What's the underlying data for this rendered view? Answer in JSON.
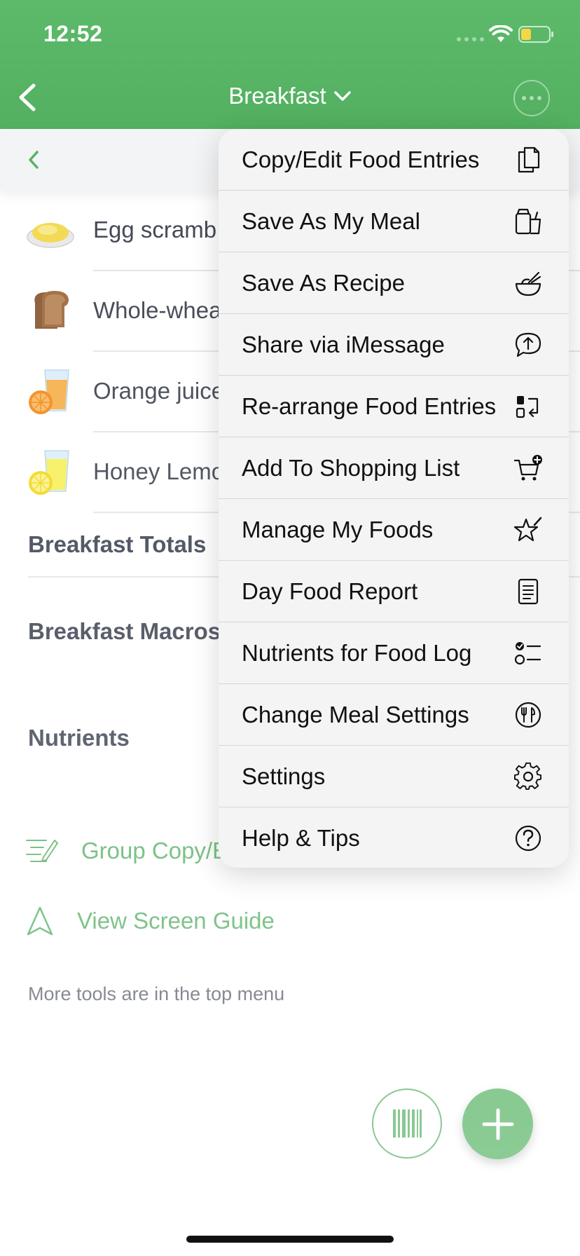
{
  "status": {
    "time": "12:52"
  },
  "header": {
    "title": "Breakfast"
  },
  "foods": [
    {
      "name": "Egg scramb",
      "icon": "scrambled-egg-icon"
    },
    {
      "name": "Whole-whea",
      "icon": "bread-toast-icon"
    },
    {
      "name": "Orange juice",
      "icon": "orange-juice-icon"
    },
    {
      "name": "Honey Lemo",
      "icon": "lemon-drink-icon"
    }
  ],
  "sections": {
    "totals": "Breakfast Totals",
    "macros": "Breakfast Macros",
    "nutrients": "Nutrients"
  },
  "links": {
    "group_copy": "Group Copy/E",
    "screen_guide": "View Screen Guide"
  },
  "footnote": "More tools are in the top menu",
  "menu": {
    "items": [
      {
        "label": "Copy/Edit Food Entries",
        "icon": "copy-documents-icon"
      },
      {
        "label": "Save As My Meal",
        "icon": "meal-containers-icon"
      },
      {
        "label": "Save As Recipe",
        "icon": "mixing-bowl-icon"
      },
      {
        "label": "Share via iMessage",
        "icon": "message-share-icon"
      },
      {
        "label": "Re-arrange Food Entries",
        "icon": "rearrange-icon"
      },
      {
        "label": "Add To Shopping List",
        "icon": "cart-add-icon"
      },
      {
        "label": "Manage My Foods",
        "icon": "star-edit-icon"
      },
      {
        "label": "Day Food Report",
        "icon": "report-icon"
      },
      {
        "label": "Nutrients for Food Log",
        "icon": "checklist-icon"
      },
      {
        "label": "Change Meal Settings",
        "icon": "fork-knife-icon"
      },
      {
        "label": "Settings",
        "icon": "gear-icon"
      },
      {
        "label": "Help & Tips",
        "icon": "question-icon"
      }
    ]
  },
  "colors": {
    "brand_green": "#56b064",
    "header_green": "#5cba6a",
    "menu_bg": "#f4f4f4"
  }
}
